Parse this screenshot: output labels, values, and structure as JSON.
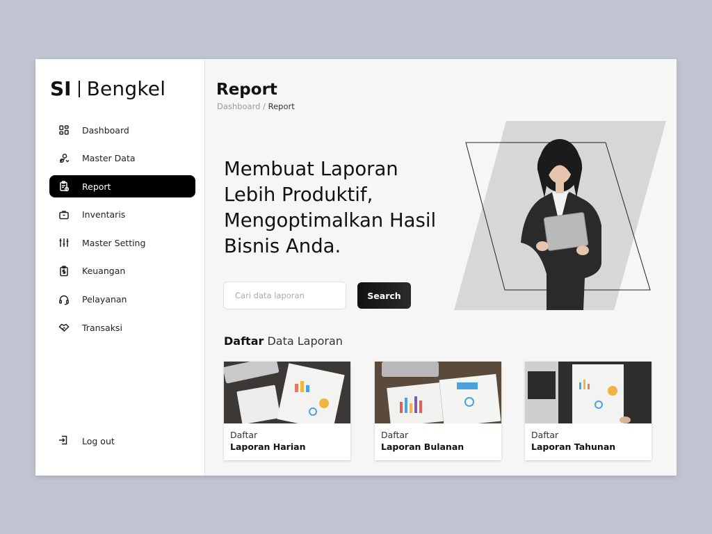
{
  "app": {
    "logo_short": "SI",
    "logo_name": "Bengkel"
  },
  "sidebar": {
    "items": [
      {
        "label": "Dashboard",
        "icon": "dashboard-icon",
        "active": false
      },
      {
        "label": "Master Data",
        "icon": "master-data-icon",
        "active": false
      },
      {
        "label": "Report",
        "icon": "report-icon",
        "active": true
      },
      {
        "label": "Inventaris",
        "icon": "briefcase-icon",
        "active": false
      },
      {
        "label": "Master Setting",
        "icon": "sliders-icon",
        "active": false
      },
      {
        "label": "Keuangan",
        "icon": "finance-icon",
        "active": false
      },
      {
        "label": "Pelayanan",
        "icon": "headset-icon",
        "active": false
      },
      {
        "label": "Transaksi",
        "icon": "handshake-icon",
        "active": false
      }
    ],
    "logout_label": "Log out"
  },
  "header": {
    "title": "Report",
    "breadcrumb": {
      "parent": "Dashboard",
      "separator": " / ",
      "current": "Report"
    }
  },
  "hero": {
    "lines": [
      "Membuat Laporan",
      "Lebih Produktif,",
      "Mengoptimalkan Hasil",
      "Bisnis Anda."
    ],
    "search_placeholder": "Cari data laporan",
    "search_button": "Search"
  },
  "section": {
    "title_bold": "Daftar",
    "title_rest": "Data Laporan"
  },
  "cards": [
    {
      "caption": "Daftar",
      "title": "Laporan Harian"
    },
    {
      "caption": "Daftar",
      "title": "Laporan Bulanan"
    },
    {
      "caption": "Daftar",
      "title": "Laporan Tahunan"
    }
  ],
  "colors": {
    "page_bg": "#c0c4d0",
    "panel_bg": "#f6f6f7",
    "active_bg": "#000000",
    "button_bg": "#111111"
  }
}
